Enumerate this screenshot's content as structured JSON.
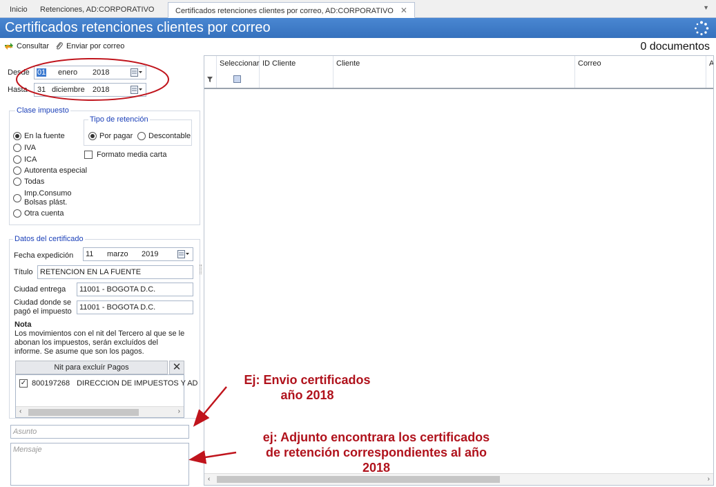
{
  "tabs": [
    {
      "label": "Inicio"
    },
    {
      "label": "Retenciones, AD:CORPORATIVO"
    },
    {
      "label": "Certificados retenciones clientes por correo, AD:CORPORATIVO"
    }
  ],
  "window_title": "Certificados retenciones clientes por correo",
  "toolbar": {
    "consultar_label": "Consultar",
    "enviar_label": "Enviar por correo",
    "doc_count": "0 documentos"
  },
  "filters": {
    "desde_label": "Desde",
    "desde": {
      "day": "01",
      "month": "enero",
      "year": "2018"
    },
    "hasta_label": "Hasta",
    "hasta": {
      "day": "31",
      "month": "diciembre",
      "year": "2018"
    }
  },
  "clase_impuesto": {
    "title": "Clase impuesto",
    "options": [
      "En la fuente",
      "IVA",
      "ICA",
      "Autorenta especial",
      "Todas",
      "Imp.Consumo",
      "Bolsas plást.",
      "Otra cuenta"
    ],
    "selected": "En la fuente"
  },
  "tipo_retencion": {
    "title": "Tipo de retención",
    "options": [
      "Por pagar",
      "Descontable"
    ],
    "selected": "Por pagar"
  },
  "formato_media_carta_label": "Formato media carta",
  "certificado": {
    "title": "Datos del certificado",
    "fecha_label": "Fecha expedición",
    "fecha": {
      "day": "11",
      "month": "marzo",
      "year": "2019"
    },
    "titulo_label": "Título",
    "titulo_value": "RETENCION EN LA FUENTE",
    "ciudad_entrega_label": "Ciudad entrega",
    "ciudad_entrega_value": "11001 - BOGOTA D.C.",
    "ciudad_pago_label_1": "Ciudad donde se",
    "ciudad_pago_label_2": "pagó el impuesto",
    "ciudad_pago_value": "11001 - BOGOTA D.C."
  },
  "nota": {
    "title": "Nota",
    "line1": "Los movimientos con el nit del Tercero al que se le",
    "line2": "abonan los impuestos, serán excluídos del",
    "line3": "informe. Se asume que son los pagos."
  },
  "nit_excluir": {
    "header": "Nit para excluír Pagos",
    "items": [
      {
        "nit": "800197268",
        "name": "DIRECCION DE IMPUESTOS Y AD",
        "checked": true
      }
    ]
  },
  "asunto_placeholder": "Asunto",
  "mensaje_placeholder": "Mensaje",
  "grid": {
    "columns": [
      "Seleccionar",
      "ID Cliente",
      "Cliente",
      "Correo",
      "A"
    ]
  },
  "annotations": {
    "asunto_1": "Ej: Envio certificados",
    "asunto_2": "año 2018",
    "mensaje_1": "ej: Adjunto encontrara los certificados",
    "mensaje_2": "de retención correspondientes al año",
    "mensaje_3": "2018"
  },
  "colors": {
    "title_bar": "#3d7cc9",
    "annotation": "#b0121c",
    "group_title": "#1a3fb8"
  }
}
